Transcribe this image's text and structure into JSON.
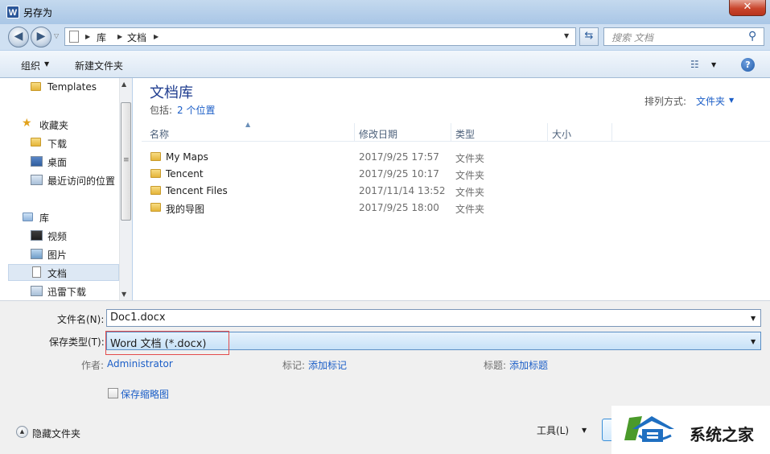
{
  "window": {
    "title": "另存为",
    "app_icon_letter": "W",
    "close_glyph": "✕"
  },
  "address_bar": {
    "crumbs": [
      "库",
      "文档"
    ],
    "search_placeholder": "搜索 文档"
  },
  "toolbar": {
    "organize_label": "组织",
    "new_folder_label": "新建文件夹"
  },
  "nav_pane": {
    "items": [
      {
        "label": "Templates",
        "icon": "folder-icon"
      },
      {
        "label": "收藏夹",
        "icon": "star-icon"
      },
      {
        "label": "下载",
        "icon": "download-folder-icon"
      },
      {
        "label": "桌面",
        "icon": "desktop-icon"
      },
      {
        "label": "最近访问的位置",
        "icon": "recent-places-icon"
      },
      {
        "label": "库",
        "icon": "library-icon"
      },
      {
        "label": "视频",
        "icon": "video-icon"
      },
      {
        "label": "图片",
        "icon": "picture-icon"
      },
      {
        "label": "文档",
        "icon": "document-icon",
        "selected": true
      },
      {
        "label": "迅雷下载",
        "icon": "thunder-download-icon"
      }
    ]
  },
  "library": {
    "title": "文档库",
    "includes_label": "包括:",
    "locations_link": "2 个位置",
    "arrange_label": "排列方式:",
    "arrange_value": "文件夹"
  },
  "file_list": {
    "columns": [
      "名称",
      "修改日期",
      "类型",
      "大小"
    ],
    "rows": [
      {
        "name": "My Maps",
        "date": "2017/9/25 17:57",
        "type": "文件夹",
        "size": ""
      },
      {
        "name": "Tencent",
        "date": "2017/9/25 10:17",
        "type": "文件夹",
        "size": ""
      },
      {
        "name": "Tencent Files",
        "date": "2017/11/14 13:52",
        "type": "文件夹",
        "size": ""
      },
      {
        "name": "我的导图",
        "date": "2017/9/25 18:00",
        "type": "文件夹",
        "size": ""
      }
    ]
  },
  "form": {
    "filename_label": "文件名(N):",
    "filename_value": "Doc1.docx",
    "savetype_label": "保存类型(T):",
    "savetype_value": "Word 文档 (*.docx)",
    "author_label": "作者:",
    "author_value": "Administrator",
    "tags_label": "标记:",
    "tags_link": "添加标记",
    "title_label": "标题:",
    "title_link": "添加标题",
    "thumbnail_label": "保存缩略图",
    "hide_folders_label": "隐藏文件夹",
    "tools_label": "工具(L)"
  },
  "watermark": {
    "text": "系统之家"
  },
  "colors": {
    "link": "#1b5ec7",
    "highlight_border": "#e34b4b",
    "library_title": "#1e3c8f"
  }
}
